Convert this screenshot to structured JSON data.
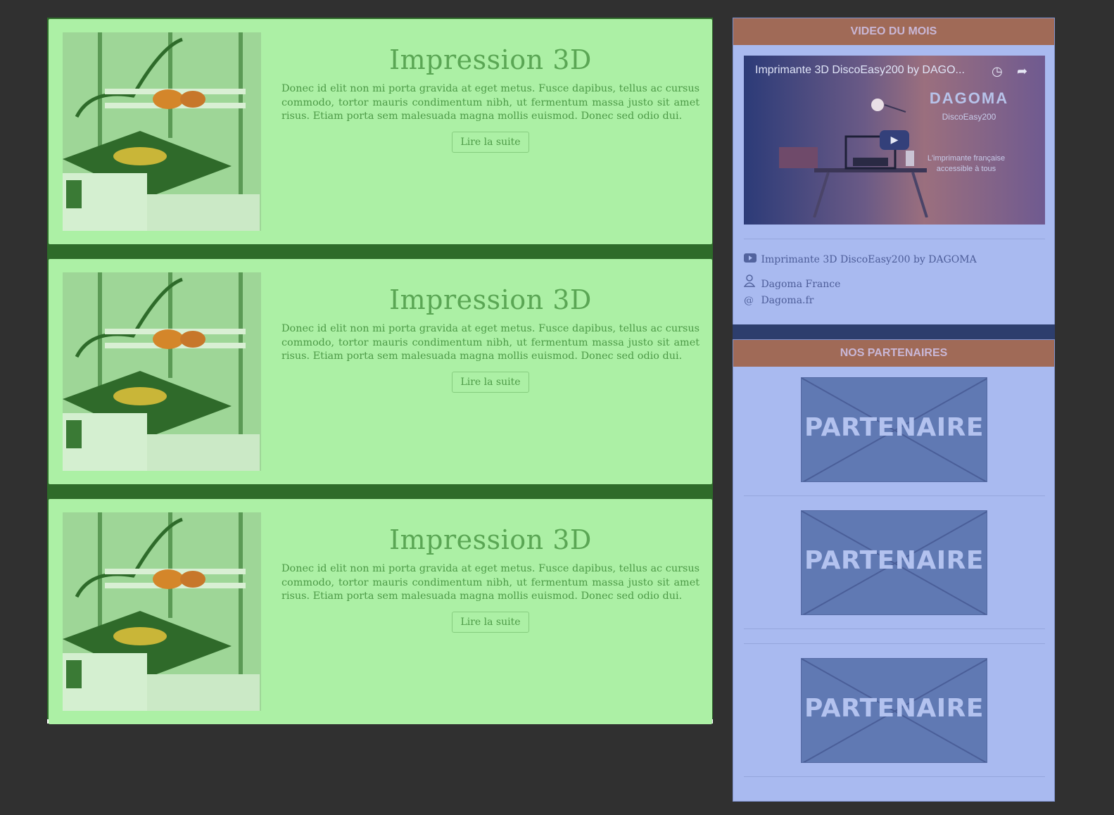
{
  "articles": [
    {
      "title": "Impression 3D",
      "text": "Donec id elit non mi porta gravida at eget metus. Fusce dapibus, tellus ac cursus commodo, tortor mauris condimentum nibh, ut fermentum massa justo sit amet risus. Etiam porta sem malesuada magna mollis euismod. Donec sed odio dui.",
      "button": "Lire la suite"
    },
    {
      "title": "Impression 3D",
      "text": "Donec id elit non mi porta gravida at eget metus. Fusce dapibus, tellus ac cursus commodo, tortor mauris condimentum nibh, ut fermentum massa justo sit amet risus. Etiam porta sem malesuada magna mollis euismod. Donec sed odio dui.",
      "button": "Lire la suite"
    },
    {
      "title": "Impression 3D",
      "text": "Donec id elit non mi porta gravida at eget metus. Fusce dapibus, tellus ac cursus commodo, tortor mauris condimentum nibh, ut fermentum massa justo sit amet risus. Etiam porta sem malesuada magna mollis euismod. Donec sed odio dui.",
      "button": "Lire la suite"
    }
  ],
  "video_panel": {
    "header": "VIDEO DU MOIS",
    "video_title": "Imprimante 3D DiscoEasy200 by DAGO...",
    "brand": "DAGOMA",
    "model": "DiscoEasy200",
    "tagline": "L'imprimante française accessible à tous",
    "links": [
      {
        "icon": "youtube-icon",
        "text": "Imprimante 3D DiscoEasy200 by DAGOMA"
      },
      {
        "icon": "user-icon",
        "text": "Dagoma France"
      },
      {
        "icon": "at-icon",
        "text": "Dagoma.fr"
      }
    ]
  },
  "partners_panel": {
    "header": "NOS PARTENAIRES",
    "partners": [
      "PARTENAIRE",
      "PARTENAIRE",
      "PARTENAIRE"
    ]
  },
  "colors": {
    "background": "#303030",
    "article_bg": "#acf0a5",
    "article_title": "#5aa654",
    "sidebar_bg": "#a9baf0",
    "sidebar_header": "#a06a57",
    "partner_bg": "#6079b3"
  }
}
